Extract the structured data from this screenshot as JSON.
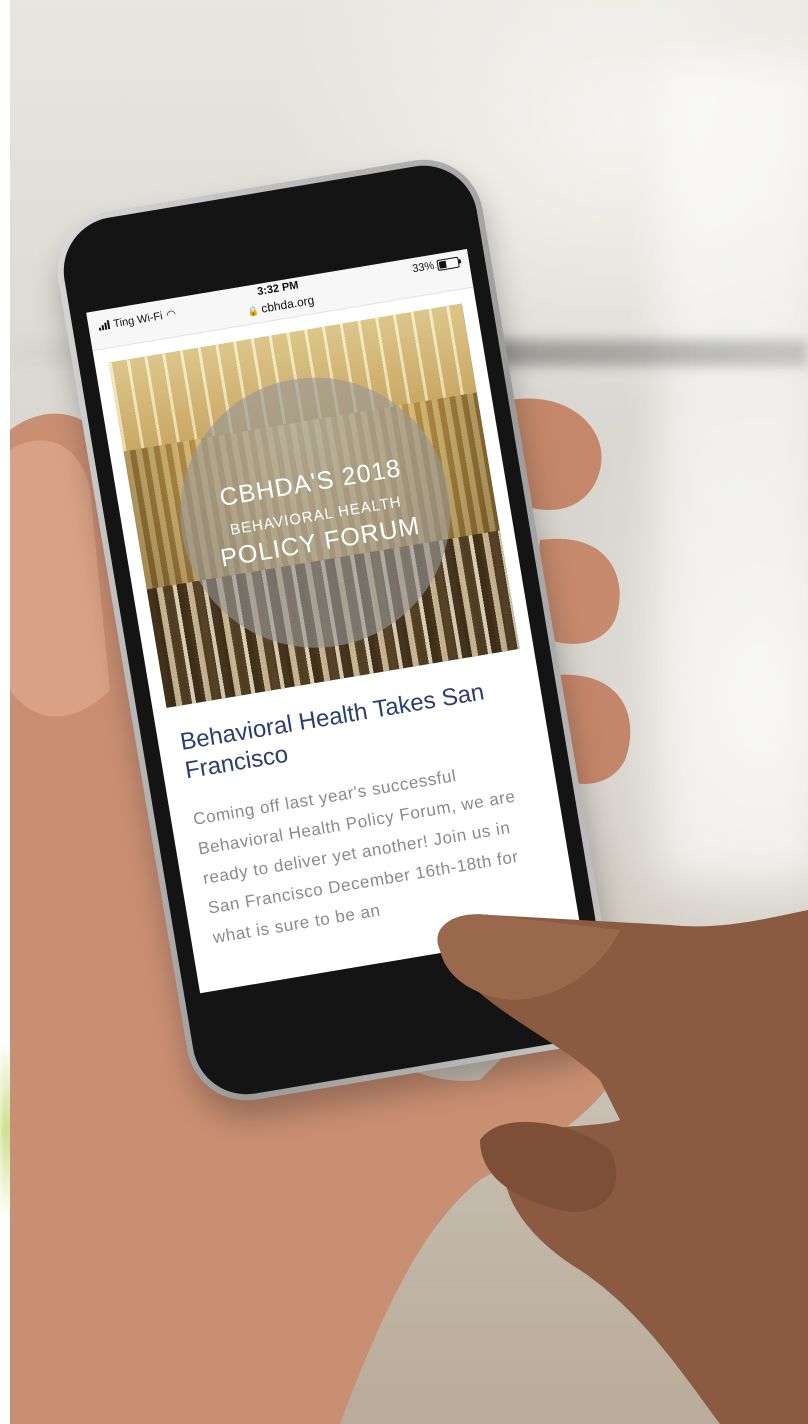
{
  "status_bar": {
    "carrier": "Ting Wi-Fi",
    "time": "3:32 PM",
    "url": "cbhda.org",
    "battery": "33%",
    "icons": {
      "signal": "signal-bars-icon",
      "wifi": "wifi-icon",
      "lock": "lock-icon",
      "battery": "battery-icon"
    }
  },
  "hero": {
    "line1": "CBHDA'S 2018",
    "line2": "BEHAVIORAL HEALTH",
    "line3": "POLICY FORUM"
  },
  "article": {
    "title": "Behavioral Health Takes San Francisco",
    "body": "Coming off last year's successful Behavioral Health Policy Forum, we are ready to deliver yet another! Join us in San Francisco December 16th-18th for what is sure to be an"
  },
  "colors": {
    "title": "#2b3f6f",
    "body": "#8a8a8a",
    "hero_overlay": "#969696"
  }
}
